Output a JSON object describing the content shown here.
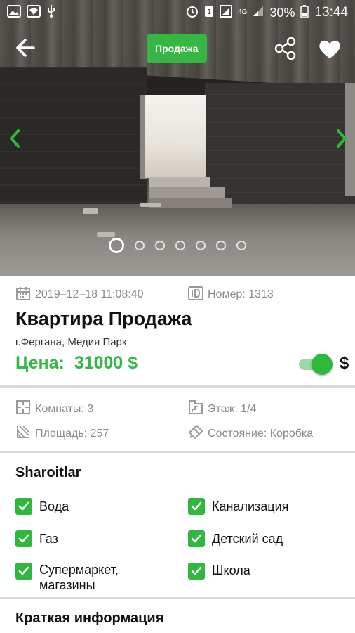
{
  "status_bar": {
    "battery": "30%",
    "time": "13:44",
    "network": "4G"
  },
  "header": {
    "badge": "Продажа",
    "icons": [
      "back-arrow-icon",
      "share-icon",
      "heart-icon"
    ]
  },
  "gallery": {
    "slide_count": 7,
    "active_index": 0
  },
  "listing": {
    "date": "2019–12–18 11:08:40",
    "number_label": "Номер: 1313",
    "title": "Квартира Продажа",
    "address": "г.Фергана, Медия Парк",
    "price_label": "Цена:",
    "price_value": "31000 $",
    "currency_symbol": "$",
    "currency_toggle_on": true
  },
  "specs": {
    "rooms": "Комнаты: 3",
    "floor": "Этаж: 1/4",
    "area": "Площадь: 257",
    "condition": "Состояние: Коробка"
  },
  "amenities": {
    "title": "Sharoitlar",
    "items": [
      {
        "label": "Вода",
        "checked": true
      },
      {
        "label": "Канализация",
        "checked": true
      },
      {
        "label": "Газ",
        "checked": true
      },
      {
        "label": "Детский сад",
        "checked": true
      },
      {
        "label": "Супермаркет, магазины",
        "checked": true
      },
      {
        "label": "Школа",
        "checked": true
      }
    ]
  },
  "summary": {
    "title": "Краткая информация"
  },
  "colors": {
    "accent": "#36b645",
    "divider": "#dadada",
    "muted_text": "#8a8a8a"
  }
}
